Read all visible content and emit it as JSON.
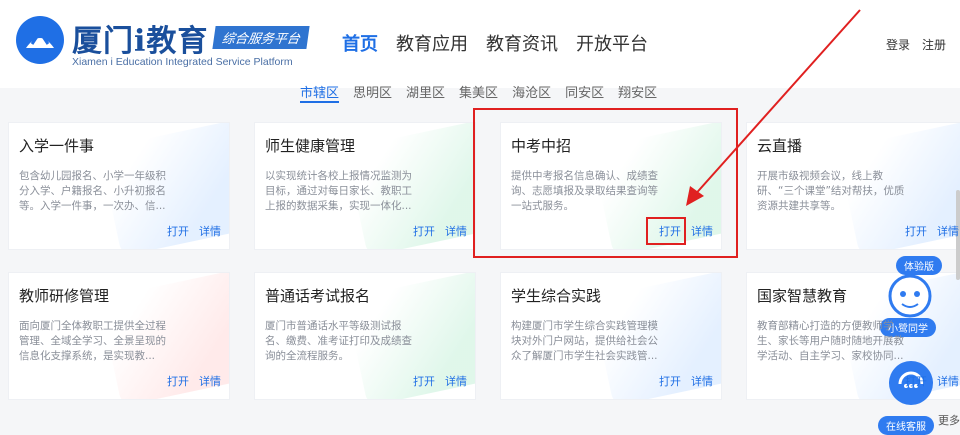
{
  "header": {
    "logo_cn": "厦门i教育",
    "logo_badge": "综合服务平台",
    "logo_en": "Xiamen i Education Integrated Service Platform",
    "nav": [
      "首页",
      "教育应用",
      "教育资讯",
      "开放平台"
    ],
    "login": "登录",
    "register": "注册"
  },
  "districts": [
    "市辖区",
    "思明区",
    "湖里区",
    "集美区",
    "海沧区",
    "同安区",
    "翔安区"
  ],
  "cards": [
    {
      "title": "入学一件事",
      "desc": "包含幼儿园报名、小学一年级积分入学、户籍报名、小升初报名等。入学一件事，一次办、信...",
      "open": "打开",
      "detail": "详情"
    },
    {
      "title": "师生健康管理",
      "desc": "以实现统计各校上报情况监测为目标，通过对每日家长、教职工上报的数据采集，实现一体化...",
      "open": "打开",
      "detail": "详情"
    },
    {
      "title": "中考中招",
      "desc": "提供中考报名信息确认、成绩查询、志愿填报及录取结果查询等一站式服务。",
      "open": "打开",
      "detail": "详情"
    },
    {
      "title": "云直播",
      "desc": "开展市级视频会议，线上教研、“三个课堂”结对帮扶，优质资源共建共享等。",
      "open": "打开",
      "detail": "详情"
    },
    {
      "title": "教师研修管理",
      "desc": "面向厦门全体教职工提供全过程管理、全域全学习、全景呈现的信息化支撑系统，是实现教...",
      "open": "打开",
      "detail": "详情"
    },
    {
      "title": "普通话考试报名",
      "desc": "厦门市普通话水平等级测试报名、缴费、准考证打印及成绩查询的全流程服务。",
      "open": "打开",
      "detail": "详情"
    },
    {
      "title": "学生综合实践",
      "desc": "构建厦门市学生综合实践管理模块对外门户网站，提供给社会公众了解厦门市学生社会实践管...",
      "open": "打开",
      "detail": "详情"
    },
    {
      "title": "国家智慧教育",
      "desc": "教育部精心打造的方便教师学生、家长等用户随时随地开展教学活动、自主学习、家校协同...",
      "open": "打开",
      "detail": "详情"
    }
  ],
  "float": {
    "trial": "体验版",
    "assistant": "小鹭同学",
    "service": "在线客服",
    "more": "更多"
  },
  "colors": {
    "accent": "#1f6fe5",
    "highlight": "#e02020"
  }
}
